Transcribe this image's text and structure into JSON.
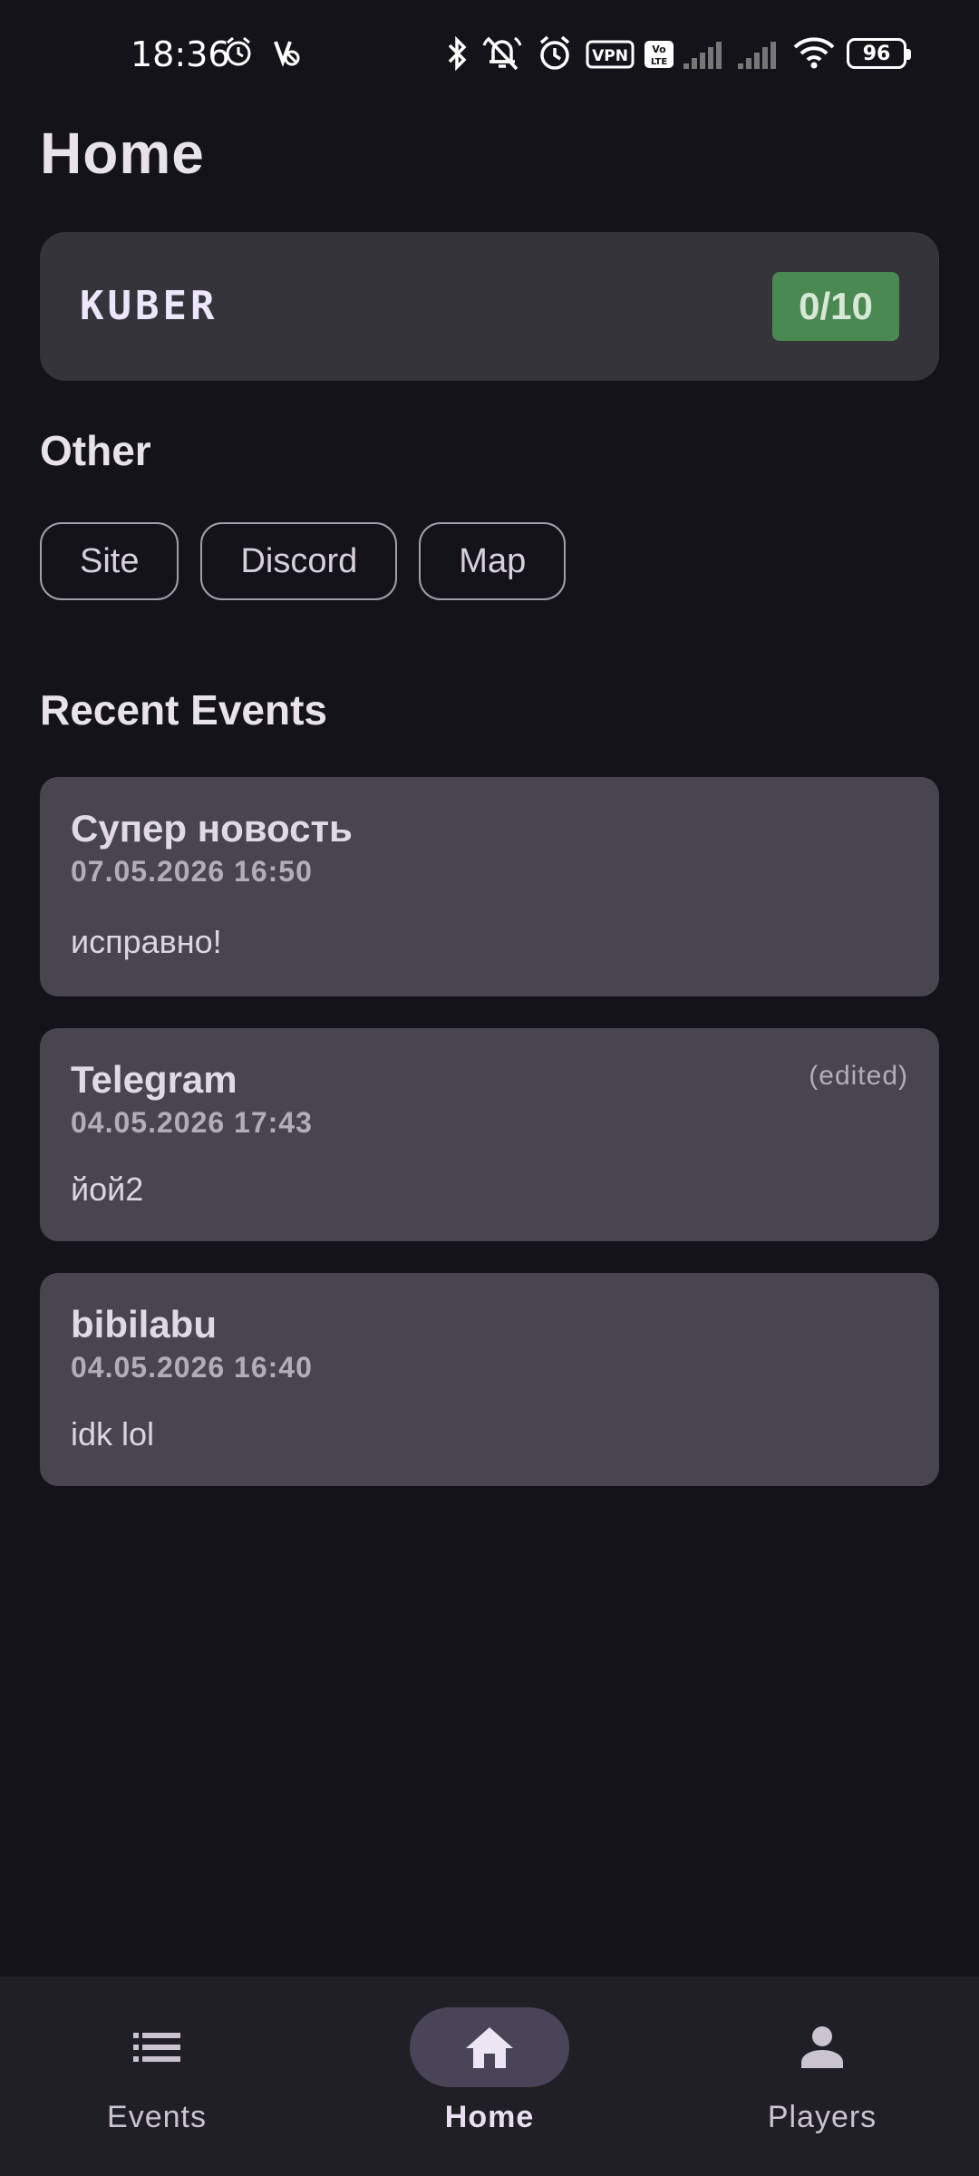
{
  "status_bar": {
    "time": "18:36",
    "battery": "96",
    "icons": [
      "alarm-icon",
      "no-wifi-calling-icon",
      "bluetooth-icon",
      "mute-icon",
      "alarm-icon",
      "vpn-icon",
      "volte-icon",
      "signal-icon",
      "signal-icon",
      "wifi-icon",
      "battery-icon"
    ],
    "vpn_label": "VPN"
  },
  "header": {
    "title": "Home"
  },
  "server": {
    "name": "KUBER",
    "players": "0/10",
    "players_color": "#4a8a52"
  },
  "other": {
    "title": "Other",
    "links": [
      "Site",
      "Discord",
      "Map"
    ]
  },
  "recent_events": {
    "title": "Recent Events",
    "items": [
      {
        "title": "Супер новость",
        "date": "07.05.2026 16:50",
        "body": "исправно!",
        "edited": ""
      },
      {
        "title": "Telegram",
        "date": "04.05.2026 17:43",
        "body": "йой2",
        "edited": "(edited)"
      },
      {
        "title": "bibilabu",
        "date": "04.05.2026 16:40",
        "body": "idk lol",
        "edited": ""
      }
    ]
  },
  "bottom_nav": {
    "items": [
      {
        "label": "Events",
        "icon": "list-icon",
        "active": false
      },
      {
        "label": "Home",
        "icon": "home-icon",
        "active": true
      },
      {
        "label": "Players",
        "icon": "person-icon",
        "active": false
      }
    ]
  },
  "colors": {
    "background": "#15131a",
    "card": "#36343b",
    "event_card": "#49454f",
    "nav_background": "#211f26",
    "nav_active_pill": "#4a4458"
  }
}
